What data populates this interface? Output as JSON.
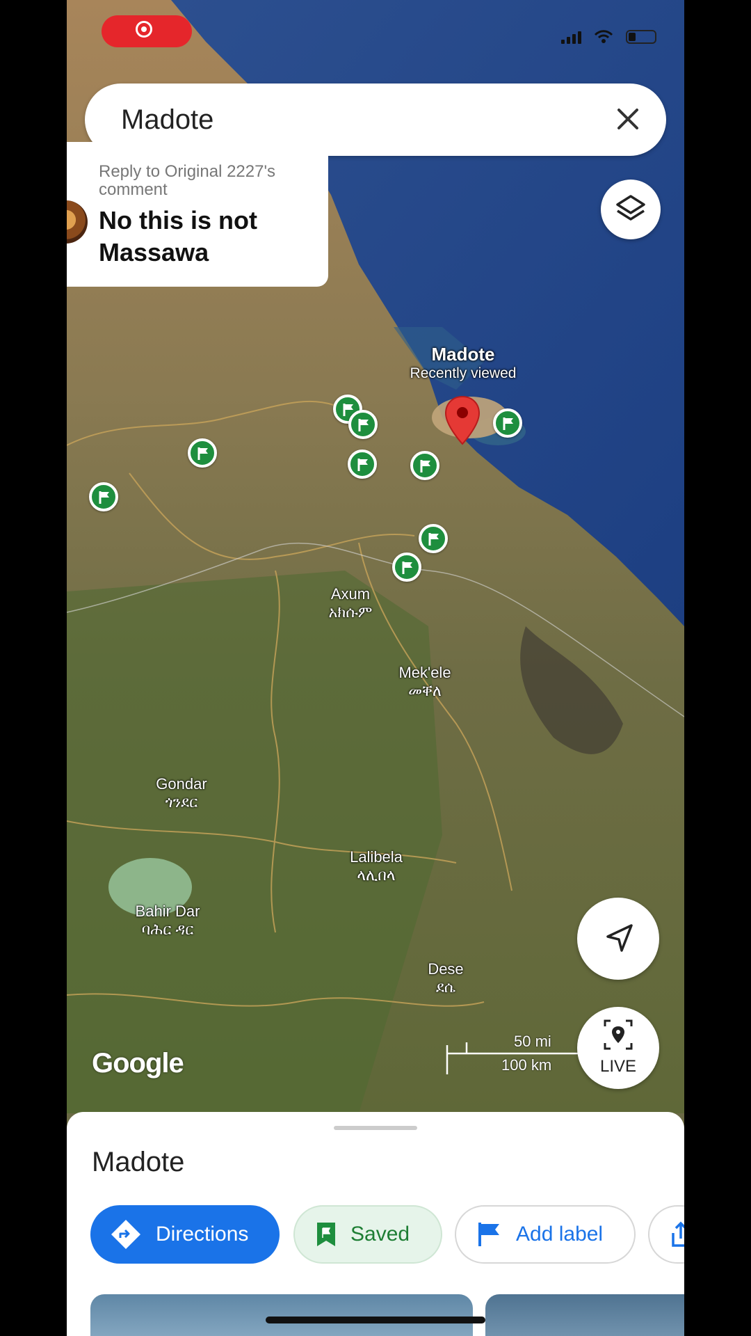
{
  "status": {
    "recording": true
  },
  "search": {
    "query": "Madote"
  },
  "comment": {
    "reply_to": "Reply to Original 2227's comment",
    "message": "No this is not Massawa"
  },
  "map": {
    "pin": {
      "name": "Madote",
      "subtitle": "Recently viewed"
    },
    "places": [
      {
        "name": "Axum",
        "local": "አክሱም"
      },
      {
        "name": "Mek'ele",
        "local": "መቐለ"
      },
      {
        "name": "Gondar",
        "local": "ጎንደር"
      },
      {
        "name": "Lalibela",
        "local": "ላሊበላ"
      },
      {
        "name": "Bahir Dar",
        "local": "ባሕር ዳር"
      },
      {
        "name": "Dese",
        "local": "ደሴ"
      }
    ],
    "scale": {
      "imperial": "50 mi",
      "metric": "100 km"
    },
    "watermark": "Google",
    "live_label": "LIVE"
  },
  "sheet": {
    "title": "Madote",
    "actions": {
      "directions": "Directions",
      "saved": "Saved",
      "add_label": "Add label"
    }
  },
  "colors": {
    "accent": "#1a73e8",
    "saved_green": "#1e8e3e",
    "pin_red": "#e53935"
  }
}
